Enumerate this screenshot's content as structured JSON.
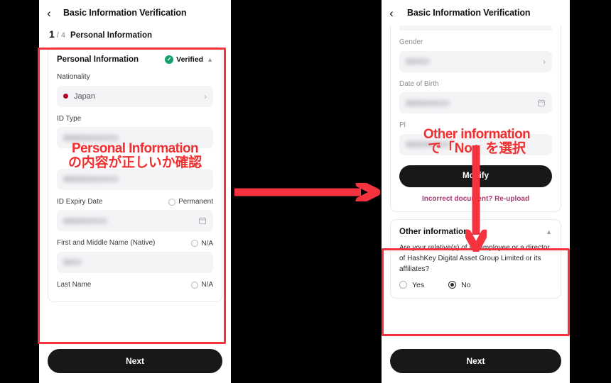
{
  "left_phone": {
    "navbar": {
      "back_icon": "chevron-left-icon",
      "title": "Basic Information Verification"
    },
    "step": {
      "current": "1",
      "total": "/ 4",
      "name": "Personal Information"
    },
    "card": {
      "title": "Personal Information",
      "status_badge": "Verified",
      "status_icon": "check-circle-icon",
      "collapse_icon": "chevron-up-icon",
      "fields": [
        {
          "label": "Nationality",
          "value": "Japan",
          "icon": "japan-flag-icon",
          "right_icon": "chevron-right-icon",
          "blurred": false
        },
        {
          "label": "ID Type",
          "value": "",
          "blurred": true,
          "blur_width": "long"
        },
        {
          "label": "",
          "value": "",
          "blurred": true,
          "blur_width": "long"
        },
        {
          "label": "ID Expiry Date",
          "value": "",
          "blurred": true,
          "blur_width": "mid",
          "right_icon": "calendar-icon",
          "side_option": "Permanent"
        },
        {
          "label": "First and Middle Name (Native)",
          "value": "",
          "blurred": true,
          "blur_width": "short",
          "side_option": "N/A"
        },
        {
          "label": "Last Name",
          "value": "",
          "blurred": true,
          "side_option": "N/A"
        }
      ]
    },
    "next_button": "Next"
  },
  "right_phone": {
    "navbar": {
      "back_icon": "chevron-left-icon",
      "title": "Basic Information Verification"
    },
    "fields": [
      {
        "label": "Gender",
        "value": "",
        "blurred": true,
        "blur_width": "tiny",
        "right_icon": "chevron-right-icon"
      },
      {
        "label": "Date of Birth",
        "value": "",
        "blurred": true,
        "blur_width": "mid",
        "right_icon": "calendar-icon"
      },
      {
        "label": "Pl",
        "value": "",
        "blurred": true,
        "blur_width": "mid"
      }
    ],
    "modify_button": "Modify",
    "reupload_link": "Incorrect document? Re-upload",
    "other_information": {
      "title": "Other information",
      "collapse_icon": "chevron-up-icon",
      "question": "Are your relative(s) of an employee or a director of HashKey Digital Asset Group Limited or its affiliates?",
      "options": [
        {
          "label": "Yes",
          "selected": false
        },
        {
          "label": "No",
          "selected": true
        }
      ]
    },
    "next_button": "Next"
  },
  "annotations": {
    "left": {
      "line1": "Personal Information",
      "line2": "の内容が正しいか確認"
    },
    "right": {
      "line1": "Other information",
      "line2": "で「No」を選択"
    },
    "arrow_between": "right-arrow-icon",
    "arrow_down": "down-arrow-icon",
    "highlight_color": "#f5333f",
    "text_color": "#f03030"
  }
}
